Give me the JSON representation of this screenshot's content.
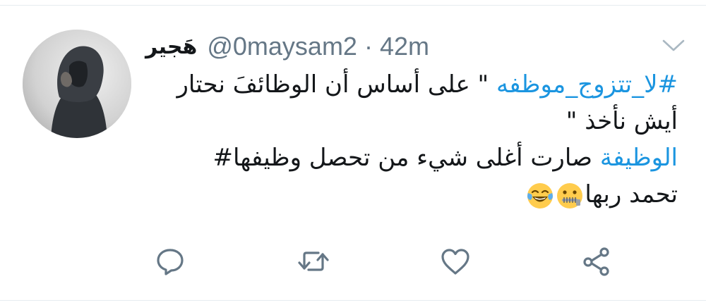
{
  "tweet": {
    "author": {
      "display_name": "هَجير",
      "handle": "@0maysam2",
      "avatar_icon": "avatar-hooded-person"
    },
    "separator": "·",
    "timestamp": "42m",
    "menu_icon": "chevron-down-icon",
    "lines": {
      "line1_hashtag": "#لا_تتزوج_موظفه",
      "line1_text": " \" على أساس أن  الوظائفَ نحتار",
      "line2_text": "أيش نأخذ \"",
      "line3_hashtag_start": "الوظيفة",
      "line3_text": " صارت أغلى شيء من تحصل وظيفها#",
      "line4_text": "تحمد ربها"
    },
    "emojis": [
      "zipper-mouth-face",
      "face-with-tears-of-joy"
    ],
    "actions": [
      {
        "name": "reply",
        "icon": "reply-icon"
      },
      {
        "name": "retweet",
        "icon": "retweet-icon"
      },
      {
        "name": "like",
        "icon": "heart-icon"
      },
      {
        "name": "share",
        "icon": "share-icon"
      }
    ],
    "colors": {
      "hashtag": "#1b95e0",
      "text": "#14171a",
      "secondary": "#657786",
      "icon": "#657786"
    }
  }
}
